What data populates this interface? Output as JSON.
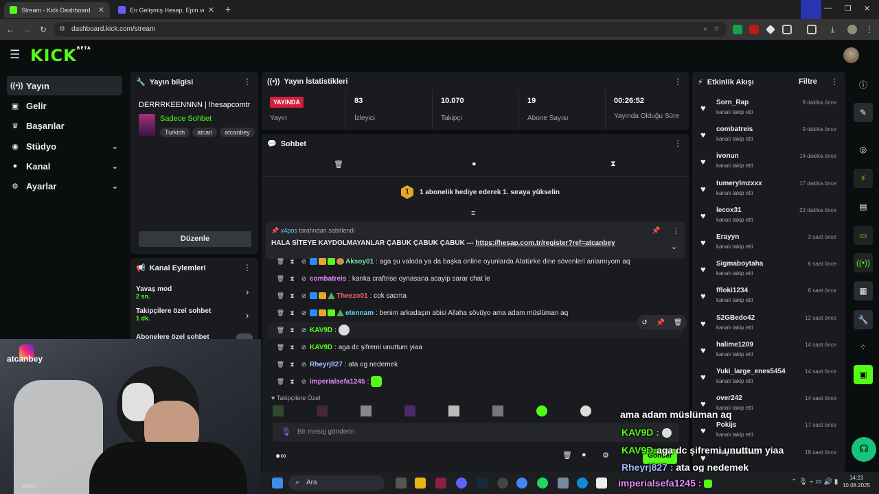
{
  "browser": {
    "tabs": [
      {
        "title": "Stream - Kick Dashboard"
      },
      {
        "title": "En Gelişmiş Hesap, Epin ve İtem"
      }
    ],
    "url": "dashboard.kick.com/stream"
  },
  "brand": {
    "logo": "KICK",
    "beta": "BETA",
    "accent": "#53fc18"
  },
  "sidebar": {
    "items": [
      {
        "label": "Yayın",
        "icon": "broadcast-icon"
      },
      {
        "label": "Gelir",
        "icon": "wallet-icon"
      },
      {
        "label": "Başarılar",
        "icon": "trophy-icon"
      },
      {
        "label": "Stüdyo",
        "icon": "camera-icon"
      },
      {
        "label": "Kanal",
        "icon": "user-icon"
      },
      {
        "label": "Ayarlar",
        "icon": "gear-icon"
      }
    ]
  },
  "stream_info": {
    "title": "Yayın bilgisi",
    "stream_title": "DERRRKEENNNN | !hesapcomtr",
    "category": "Sadece Sohbet",
    "tags": [
      "Turkish",
      "atcan",
      "atcanbey"
    ],
    "edit": "Düzenle"
  },
  "channel_actions": {
    "title": "Kanal Eylemleri",
    "items": [
      {
        "label": "Yavaş mod",
        "sub": "2 sn."
      },
      {
        "label": "Takipçilere özel sohbet",
        "sub": "1 dk."
      },
      {
        "label": "Abonelere özel sohbet",
        "sub": ""
      }
    ]
  },
  "stats": {
    "title": "Yayın İstatistikleri",
    "live_badge": "YAYINDA",
    "items": [
      {
        "value": "",
        "label": "Yayın"
      },
      {
        "value": "83",
        "label": "İzleyici"
      },
      {
        "value": "10.070",
        "label": "Takipçi"
      },
      {
        "value": "19",
        "label": "Abone Sayısı"
      },
      {
        "value": "00:26:52",
        "label": "Yayında Olduğu Süre"
      }
    ]
  },
  "chat": {
    "title": "Sohbet",
    "gift_rank": "1",
    "gift_text": "1 abonelik hediye ederek 1. sıraya yükselin",
    "pinned_by": "x4pos",
    "pinned_by_suffix": "tarafından sabitlendi",
    "pinned_text": "HALA SİTEYE KAYDOLMAYANLAR ÇABUK ÇABUK ÇABUK ---",
    "pinned_link": "https://hesap.com.tr/register?ref=atcanbey",
    "messages": [
      {
        "user": "Aksoy01",
        "text": "aga şu valoda ya da başka online oyunlarda Atatürke dine sövenleri anlamıyom aq",
        "color": "#7fe3a8"
      },
      {
        "user": "combatreis",
        "text": "kanka craftrise oynasana acayip sarar chat le",
        "color": "#e08cf5"
      },
      {
        "user": "Theezo01",
        "text": "cok sacma",
        "color": "#ff5a6a"
      },
      {
        "user": "etennam",
        "text": "benim arkadaşın abisi Allaha sövüyo ama adam müslüman aq",
        "color": "#6fd0f5"
      },
      {
        "user": "KAV9D",
        "text": "",
        "color": "#53fc18"
      },
      {
        "user": "KAV9D",
        "text": "aga dc şifremi unuttum yiaa",
        "color": "#53fc18"
      },
      {
        "user": "Rheyrj827",
        "text": "ata og nedemek",
        "color": "#9fc0ff"
      },
      {
        "user": "imperialsefa1245",
        "text": "",
        "color": "#e08cf5"
      }
    ],
    "followers_only": "Takipçilere Özel",
    "input_placeholder": "Bir mesaj gönderin",
    "send": "Gönder"
  },
  "activity": {
    "title": "Etkinlik Akışı",
    "filter": "Filtre",
    "events": [
      {
        "name": "Sorn_Rap",
        "sub": "kanalı takip etti",
        "time": "8 dakika önce"
      },
      {
        "name": "combatreis",
        "sub": "kanalı takip etti",
        "time": "9 dakika önce"
      },
      {
        "name": "ivonun",
        "sub": "kanalı takip etti",
        "time": "14 dakika önce"
      },
      {
        "name": "tumerylmzxxx",
        "sub": "kanalı takip etti",
        "time": "17 dakika önce"
      },
      {
        "name": "lecox31",
        "sub": "kanalı takip etti",
        "time": "22 dakika önce"
      },
      {
        "name": "Erayyn",
        "sub": "kanalı takip etti",
        "time": "3 saat önce"
      },
      {
        "name": "Sigmaboytaha",
        "sub": "kanalı takip etti",
        "time": "6 saat önce"
      },
      {
        "name": "ffloki1234",
        "sub": "kanalı takip etti",
        "time": "6 saat önce"
      },
      {
        "name": "S2GBedo42",
        "sub": "kanalı takip etti",
        "time": "12 saat önce"
      },
      {
        "name": "halime1209",
        "sub": "kanalı takip etti",
        "time": "14 saat önce"
      },
      {
        "name": "Yuki_large_enes5454",
        "sub": "kanalı takip etti",
        "time": "14 saat önce"
      },
      {
        "name": "over242",
        "sub": "kanalı takip etti",
        "time": "14 saat önce"
      },
      {
        "name": "Pokijs",
        "sub": "kanalı takip etti",
        "time": "17 saat önce"
      },
      {
        "name": "Maymun0115",
        "sub": "",
        "time": "18 saat önce"
      }
    ]
  },
  "webcam": {
    "handle": "atcanbey"
  },
  "overlay": {
    "line1": "ama adam müslüman aq",
    "line2_user": "KAV9D :",
    "line3_user": "KAV9D:",
    "line3_text": "aga dc şifremi unuttum yiaa",
    "line4_user": "Rheyrj827 :",
    "line4_text": "ata og nedemek",
    "line5_user": "imperialsefa1245 :"
  },
  "taskbar": {
    "search": "Ara",
    "time": "14:23",
    "date": "10.08.2025",
    "now": "Şimdi"
  }
}
